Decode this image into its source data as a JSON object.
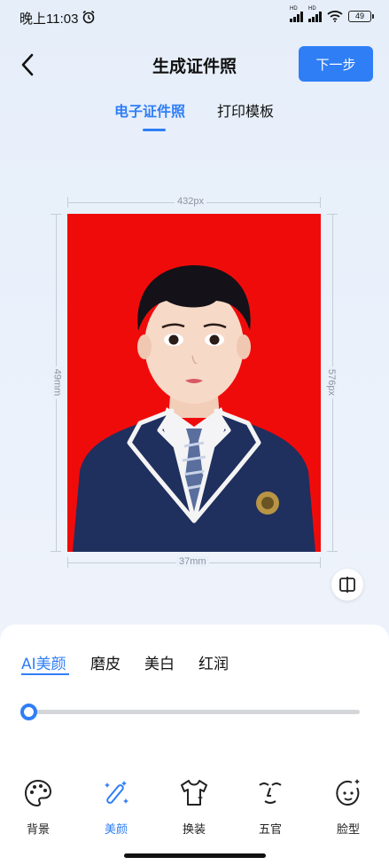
{
  "status_bar": {
    "time": "晚上11:03",
    "signal1_label": "HD",
    "signal2_label": "HD",
    "battery": "49"
  },
  "header": {
    "title": "生成证件照",
    "next_label": "下一步"
  },
  "tabs": [
    {
      "label": "电子证件照",
      "active": true
    },
    {
      "label": "打印模板",
      "active": false
    }
  ],
  "photo": {
    "background_color": "#f00b0b",
    "width_px_label": "432px",
    "height_px_label": "576px",
    "width_mm_label": "37mm",
    "height_mm_label": "49mm"
  },
  "beauty": {
    "tabs": [
      {
        "label": "AI美颜",
        "active": true
      },
      {
        "label": "磨皮",
        "active": false
      },
      {
        "label": "美白",
        "active": false
      },
      {
        "label": "红润",
        "active": false
      }
    ],
    "slider_value": 0
  },
  "toolbar": [
    {
      "label": "背景",
      "icon": "palette-icon",
      "active": false
    },
    {
      "label": "美颜",
      "icon": "magic-wand-icon",
      "active": true
    },
    {
      "label": "换装",
      "icon": "shirt-icon",
      "active": false
    },
    {
      "label": "五官",
      "icon": "face-features-icon",
      "active": false
    },
    {
      "label": "脸型",
      "icon": "face-shape-icon",
      "active": false
    }
  ],
  "colors": {
    "accent": "#2f7ef6",
    "photo_background": "#f00b0b",
    "suit": "#1f2f5e"
  }
}
